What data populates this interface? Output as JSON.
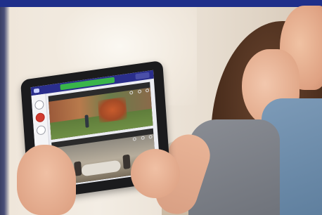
{
  "app": {
    "title": "",
    "header_button": "",
    "cameras": [
      {
        "label": ""
      },
      {
        "label": ""
      }
    ]
  },
  "colors": {
    "header": "#2a2e8c",
    "title_bar": "#39b54a",
    "record_button": "#d23b2f"
  }
}
